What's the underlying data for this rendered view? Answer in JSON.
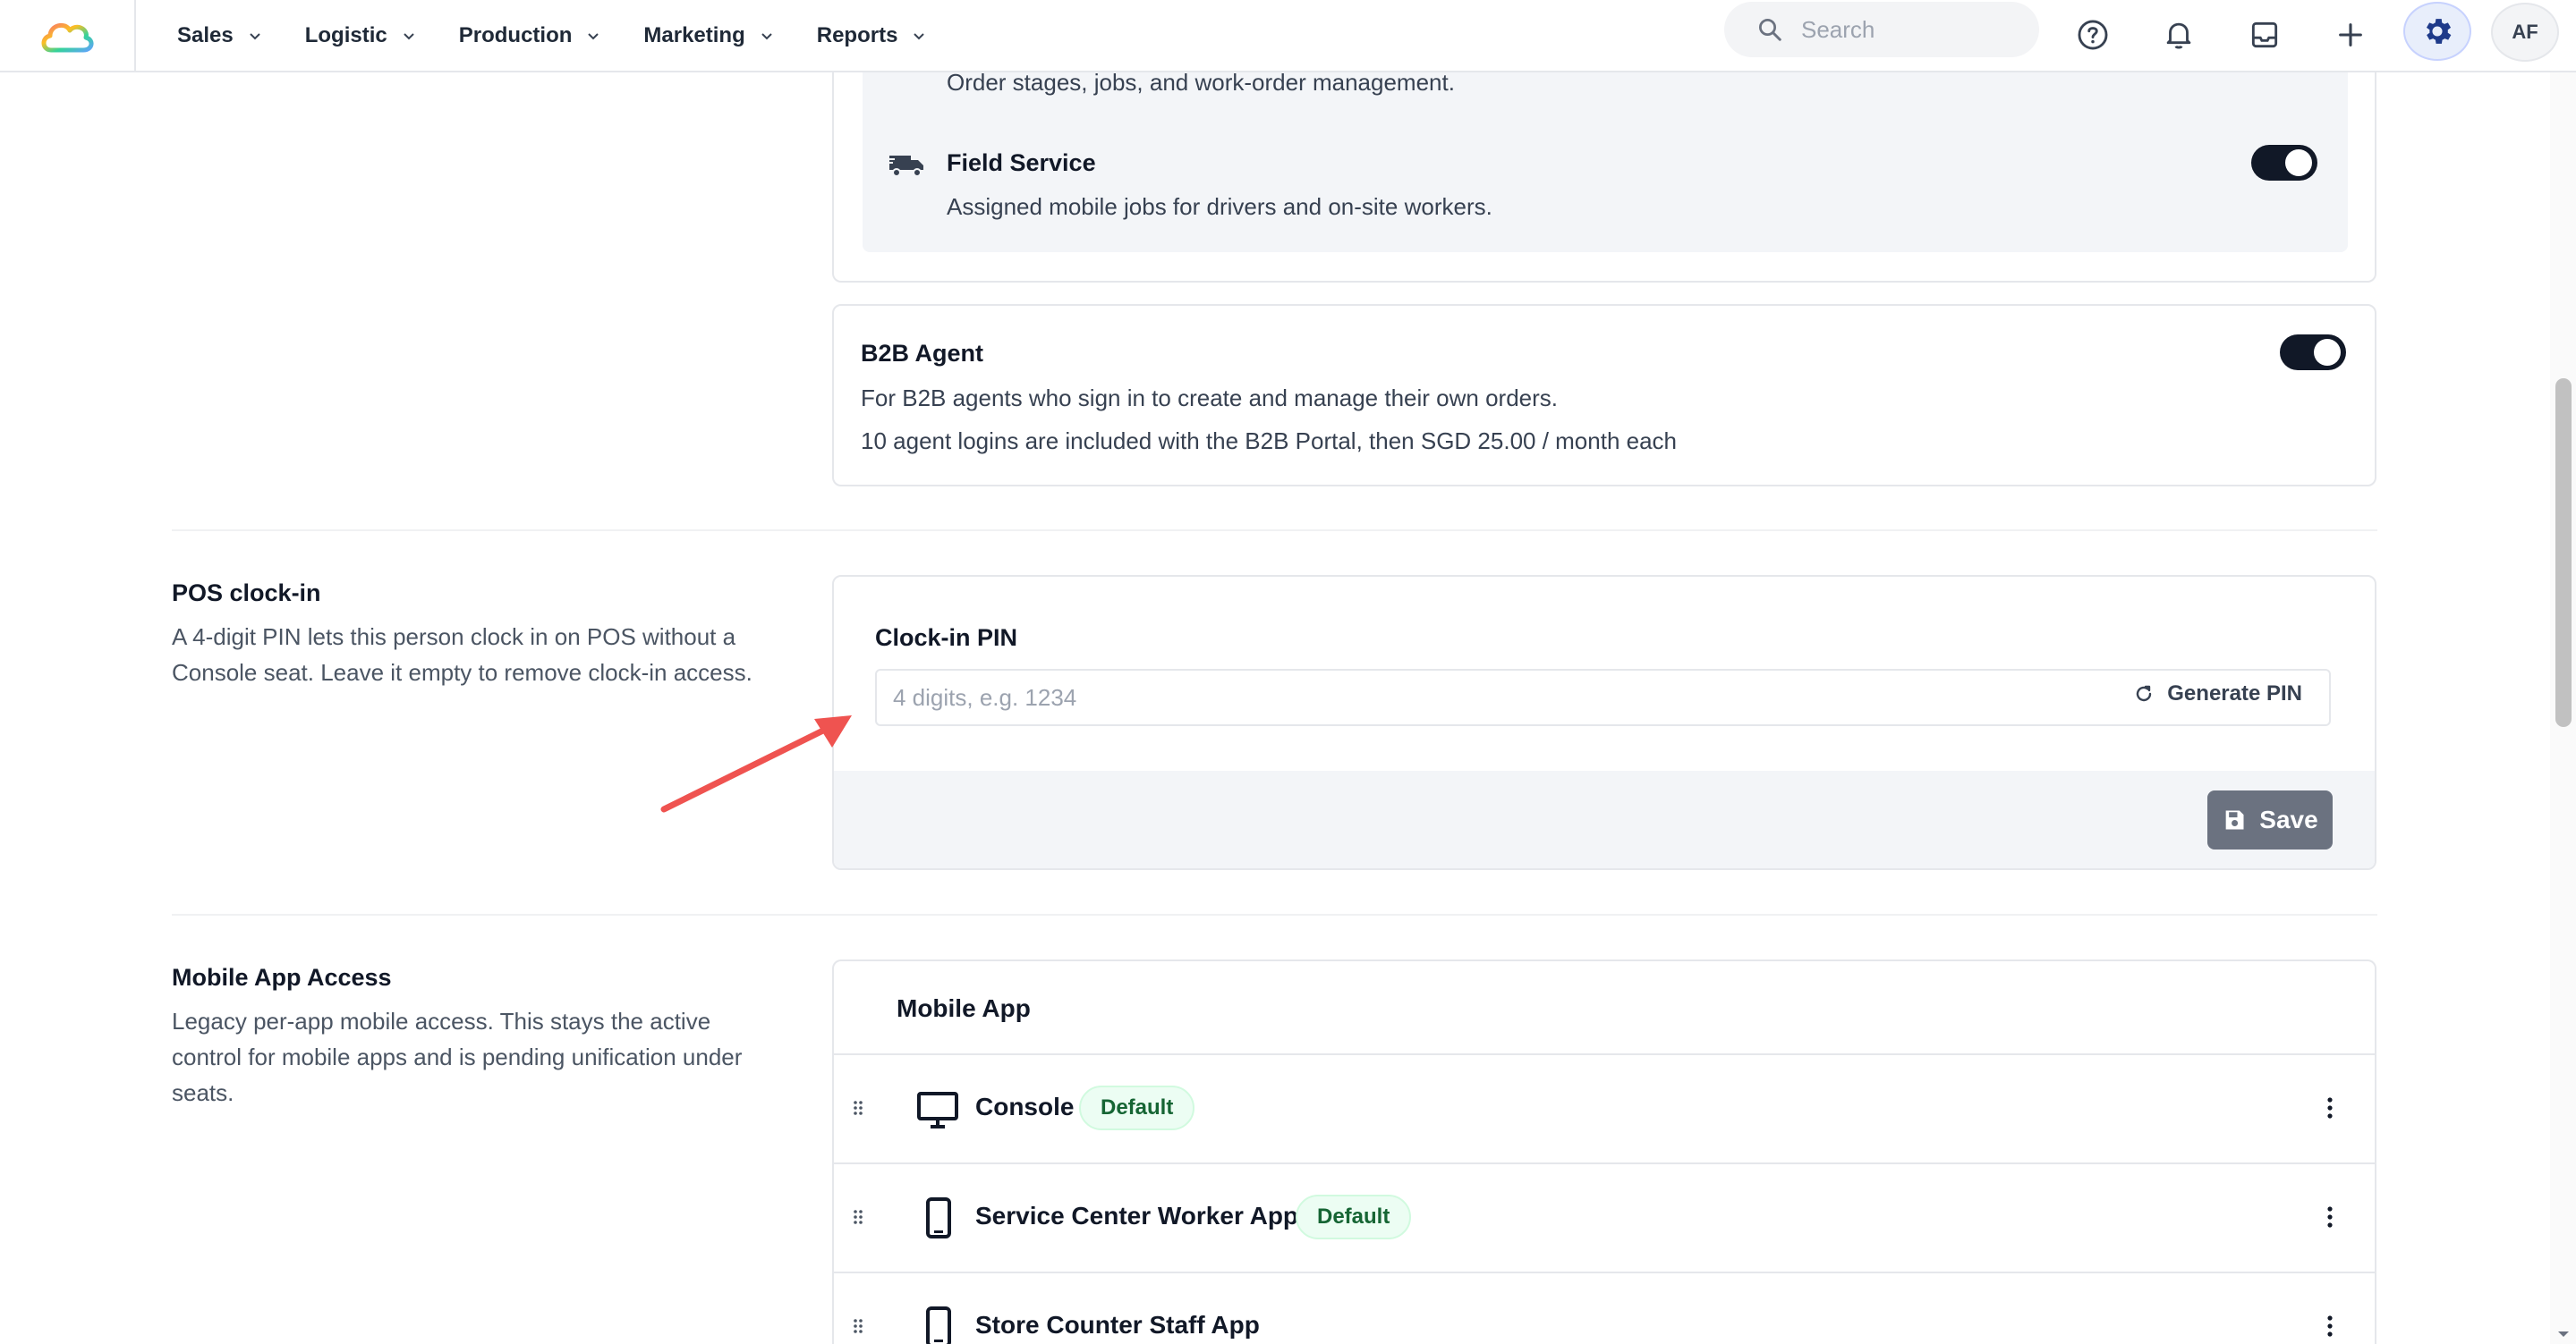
{
  "nav": {
    "items": [
      "Sales",
      "Logistic",
      "Production",
      "Marketing",
      "Reports"
    ],
    "search_placeholder": "Search",
    "avatar_initials": "AF"
  },
  "modules": {
    "top_desc": "Order stages, jobs, and work-order management.",
    "field_service": {
      "title": "Field Service",
      "desc": "Assigned mobile jobs for drivers and on-site workers.",
      "enabled": true
    },
    "b2b_agent": {
      "title": "B2B Agent",
      "desc1": "For B2B agents who sign in to create and manage their own orders.",
      "desc2": "10 agent logins are included with the B2B Portal, then SGD 25.00 / month each",
      "enabled": true
    }
  },
  "pos": {
    "section_title": "POS clock-in",
    "section_desc_1": "A 4-digit PIN lets this person clock in on POS without a",
    "section_desc_2": "Console seat. Leave it empty to remove clock-in access.",
    "field_label": "Clock-in PIN",
    "placeholder": "4 digits, e.g. 1234",
    "generate_label": "Generate PIN",
    "save_label": "Save"
  },
  "mobile": {
    "section_title": "Mobile App Access",
    "section_desc_1": "Legacy per-app mobile access. This stays the active",
    "section_desc_2": "control for mobile apps and is pending unification under",
    "section_desc_3": "seats.",
    "card_title": "Mobile App",
    "apps": [
      {
        "name": "Console",
        "badge": "Default",
        "device": "monitor-icon"
      },
      {
        "name": "Service Center Worker App",
        "badge": "Default",
        "device": "phone-icon"
      },
      {
        "name": "Store Counter Staff App",
        "badge": "",
        "device": "phone-icon"
      }
    ]
  },
  "colors": {
    "toggle_on": "#111827",
    "save_button": "#6b7280",
    "badge_bg": "#ecfdf3",
    "badge_text": "#166534",
    "annotation_arrow": "#ef5350",
    "gear_accent": "#1e3a8a"
  }
}
